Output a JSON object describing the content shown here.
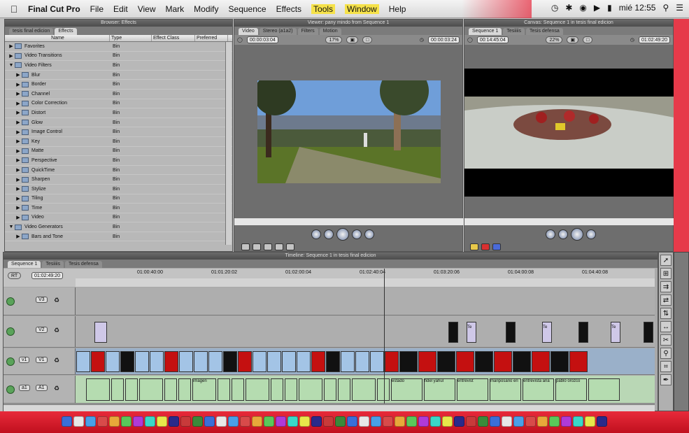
{
  "menubar": {
    "app": "Final Cut Pro",
    "items": [
      "File",
      "Edit",
      "View",
      "Mark",
      "Modify",
      "Sequence",
      "Effects",
      "Tools",
      "Window",
      "Help"
    ],
    "clock": "mié 12:55"
  },
  "browser": {
    "title": "Browser: Effects",
    "tabs": [
      "tesis final edicion",
      "Effects"
    ],
    "columns": [
      "Name",
      "Type",
      "Effect Class",
      "Preferred"
    ],
    "rows": [
      {
        "name": "Favorites",
        "type": "Bin",
        "expanded": false
      },
      {
        "name": "Video Transitions",
        "type": "Bin",
        "expanded": false
      },
      {
        "name": "Video Filters",
        "type": "Bin",
        "expanded": true
      },
      {
        "name": "Blur",
        "type": "Bin"
      },
      {
        "name": "Border",
        "type": "Bin"
      },
      {
        "name": "Channel",
        "type": "Bin"
      },
      {
        "name": "Color Correction",
        "type": "Bin"
      },
      {
        "name": "Distort",
        "type": "Bin"
      },
      {
        "name": "Glow",
        "type": "Bin"
      },
      {
        "name": "Image Control",
        "type": "Bin"
      },
      {
        "name": "Key",
        "type": "Bin"
      },
      {
        "name": "Matte",
        "type": "Bin"
      },
      {
        "name": "Perspective",
        "type": "Bin"
      },
      {
        "name": "QuickTime",
        "type": "Bin"
      },
      {
        "name": "Sharpen",
        "type": "Bin"
      },
      {
        "name": "Stylize",
        "type": "Bin"
      },
      {
        "name": "Tiling",
        "type": "Bin"
      },
      {
        "name": "Time",
        "type": "Bin"
      },
      {
        "name": "Video",
        "type": "Bin"
      },
      {
        "name": "Video Generators",
        "type": "Bin",
        "expanded": true
      },
      {
        "name": "Bars and Tone",
        "type": "Bin"
      }
    ]
  },
  "viewer": {
    "title": "Viewer: pany mindo from Sequence 1",
    "tabs": [
      "Video",
      "Stereo (a1a2)",
      "Filters",
      "Motion"
    ],
    "timecode_left": "00:00:03:04",
    "zoom": "17%",
    "timecode_right": "00:00:03:24"
  },
  "canvas": {
    "title": "Canvas: Sequence 1 in tesis final edicion",
    "tabs": [
      "Sequence 1",
      "Tesiiiis",
      "Tesis defensa"
    ],
    "timecode_left": "00:14:45:04",
    "zoom": "22%",
    "timecode_right": "01:02:49:20"
  },
  "timeline": {
    "title": "Timeline: Sequence 1 in tesis final edicion",
    "tabs": [
      "Sequence 1",
      "Tesiiiis",
      "Tesis defensa"
    ],
    "rt": "RT",
    "current_tc": "01:02:49:20",
    "ticks": [
      "01:00:40:00",
      "01:01:20:02",
      "01:02:00:04",
      "01:02:40:04",
      "01:03:20:06",
      "01:04:00:08",
      "01:04:40:08"
    ],
    "tracks": [
      "V3",
      "V2",
      "V1",
      "A1"
    ],
    "audio_labels": [
      "imagen",
      "estado",
      "fidel yahul",
      "entrevist",
      "mariposario en",
      "entrevista ana",
      "pablo orozco"
    ],
    "title_clip_label": "Te"
  }
}
